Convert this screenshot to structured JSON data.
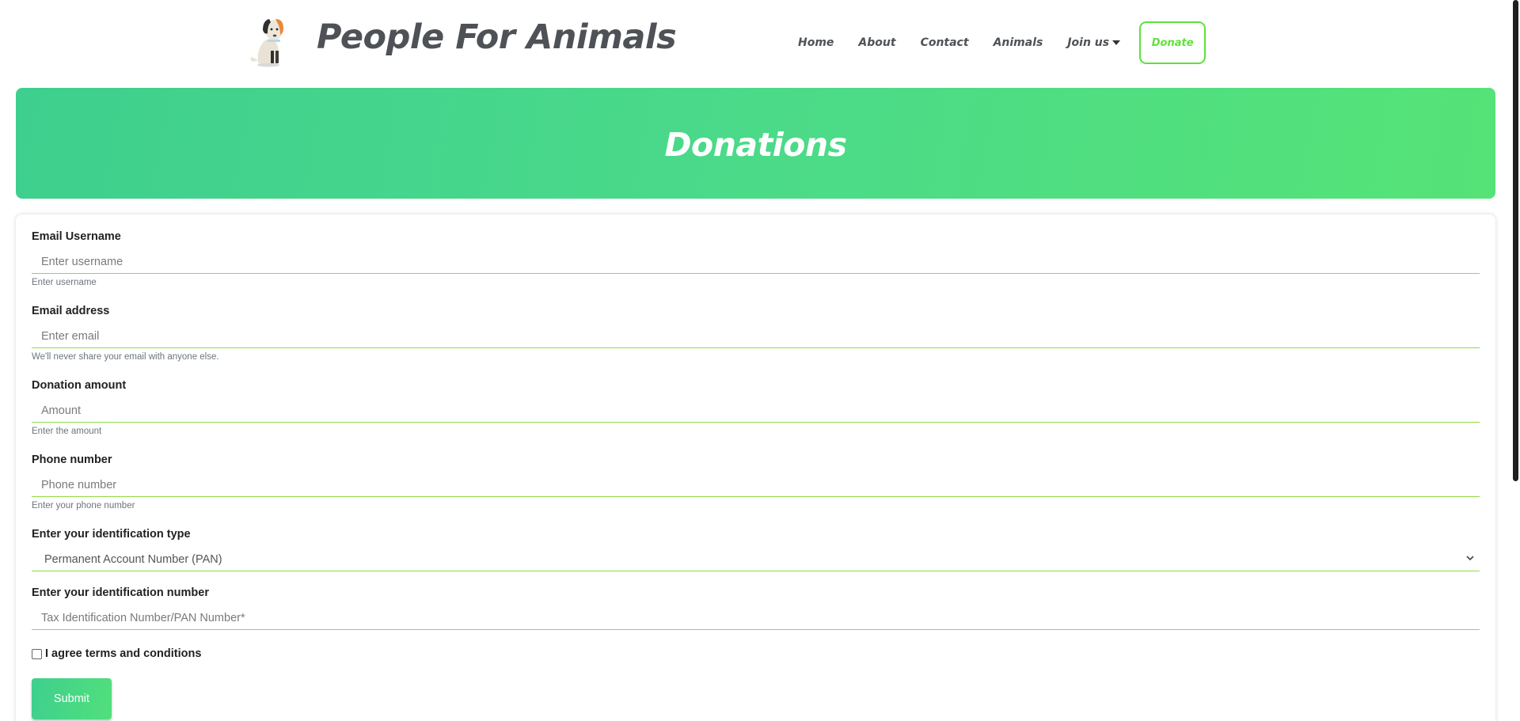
{
  "header": {
    "brand": "People For Animals",
    "nav": [
      "Home",
      "About",
      "Contact",
      "Animals"
    ],
    "join_label": "Join us",
    "donate_label": "Donate"
  },
  "banner": {
    "title": "Donations"
  },
  "form": {
    "username": {
      "label": "Email Username",
      "placeholder": "Enter username",
      "help": "Enter username"
    },
    "email": {
      "label": "Email address",
      "placeholder": "Enter email",
      "help": "We'll never share your email with anyone else."
    },
    "amount": {
      "label": "Donation amount",
      "placeholder": "Amount",
      "help": "Enter the amount"
    },
    "phone": {
      "label": "Phone number",
      "placeholder": "Phone number",
      "help": "Enter your phone number"
    },
    "id_type": {
      "label": "Enter your identification type",
      "selected": "Permanent Account Number (PAN)"
    },
    "id_number": {
      "label": "Enter your identification number",
      "placeholder": "Tax Identification Number/PAN Number*"
    },
    "agree_label": "I agree terms and conditions",
    "submit_label": "Submit"
  },
  "colors": {
    "accent": "#5ee23a",
    "banner_start": "#3ecf8e",
    "banner_end": "#55e377",
    "text_dark": "#4e5257"
  },
  "icons": [
    "dog-logo-icon",
    "caret-down-icon",
    "chevron-down-icon"
  ]
}
